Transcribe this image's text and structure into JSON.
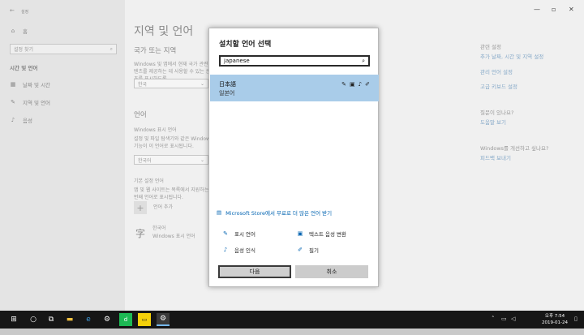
{
  "nav": {
    "window_title": "설정",
    "home_label": "홈",
    "search_placeholder": "설정 찾기",
    "section": "시간 및 언어",
    "items": [
      {
        "label": "날짜 및 시간",
        "icon": "calendar-icon"
      },
      {
        "label": "지역 및 언어",
        "icon": "language-icon"
      },
      {
        "label": "음성",
        "icon": "microphone-icon"
      }
    ]
  },
  "main": {
    "page_title": "지역 및 언어",
    "country_heading": "국가 또는 지역",
    "country_desc": "Windows 및 앱에서 현재 국가 관련 콘텐츠를 제공하는 데 사용할 수 있는 콘텐츠를 표시하도록",
    "country_value": "한국",
    "language_heading": "언어",
    "display_lang_label": "Windows 표시 언어",
    "display_lang_desc": "설정 및 파일 탐색기와 같은 Windows 기능이 이 언어로 표시됩니다.",
    "display_lang_value": "한국어",
    "preferred_label": "기본 설정 언어",
    "preferred_desc": "앱 및 웹 사이트는 목록에서 지원하는 첫 번째 언어로 표시됩니다.",
    "add_language": "언어 추가",
    "lang_name": "한국어",
    "lang_sub": "Windows 표시 언어"
  },
  "right": {
    "related_heading": "관련 설정",
    "related_links": [
      "추가 날짜, 시간 및 지역 설정",
      "관리 언어 설정",
      "고급 키보드 설정"
    ],
    "question_heading": "질문이 있나요?",
    "help_link": "도움말 보기",
    "feedback_heading": "Windows를 개선하고 싶나요?",
    "feedback_link": "피드백 보내기"
  },
  "dialog": {
    "title": "설치할 언어 선택",
    "search_value": "japanese",
    "result_name": "日本語",
    "result_sub": "일본어",
    "store_link": "Microsoft Store에서 무료로 더 많은 언어 받기",
    "features": [
      "표시 언어",
      "텍스트 음성 변환",
      "음성 인식",
      "필기"
    ],
    "next_button": "다음",
    "cancel_button": "취소"
  },
  "taskbar": {
    "time": "오후 7:54",
    "date": "2019-01-24"
  },
  "colors": {
    "accent": "#0063b1",
    "selection": "#a9cce9",
    "taskbar": "#161616"
  }
}
